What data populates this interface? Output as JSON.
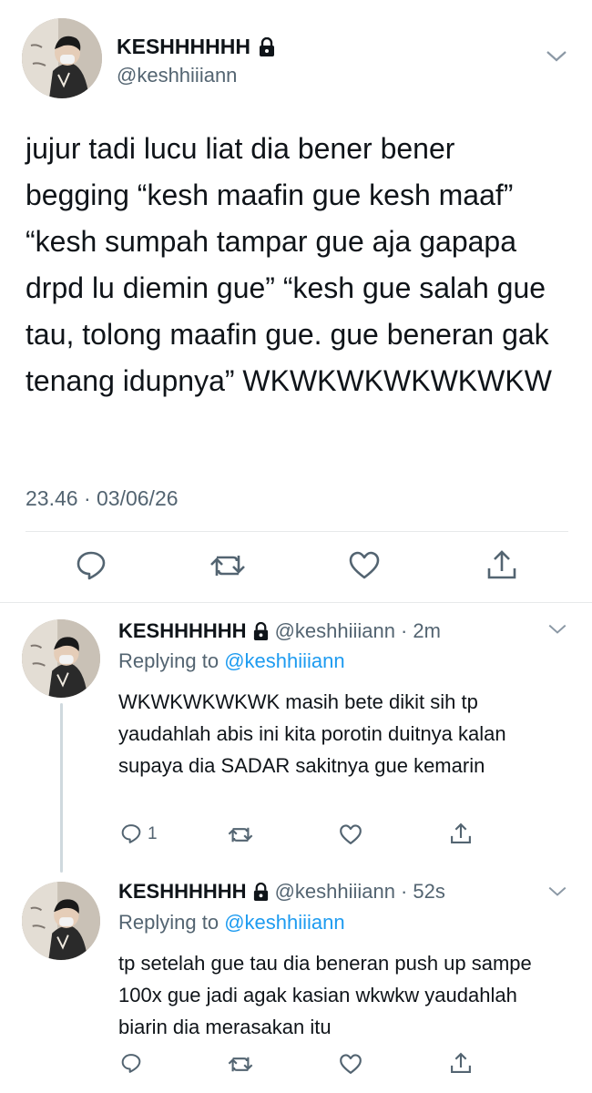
{
  "main_tweet": {
    "display_name": "KESHHHHHH",
    "handle": "@keshhiiiann",
    "text": "jujur tadi lucu liat dia bener bener begging “kesh maafin gue kesh maaf” “kesh sumpah tampar gue aja gapapa drpd lu diemin gue” “kesh gue salah gue tau, tolong maafin gue. gue beneran gak tenang idupnya” WKWKWKWKWKWKW",
    "timestamp": "23.46 · 03/06/26",
    "actions": [
      "reply-icon",
      "retweet-icon",
      "like-icon",
      "share-icon"
    ]
  },
  "replies": [
    {
      "display_name": "KESHHHHHH",
      "handle": "@keshhiiiann",
      "time": "· 2m",
      "replying_prefix": "Replying to ",
      "replying_to": "@keshhiiiann",
      "text": "WKWKWKWKWK masih bete dikit sih tp yaudahlah abis ini kita porotin duitnya kalan supaya dia SADAR sakitnya gue kemarin",
      "reply_count": "1"
    },
    {
      "display_name": "KESHHHHHH",
      "handle": "@keshhiiiann",
      "time": "· 52s",
      "replying_prefix": "Replying to ",
      "replying_to": "@keshhiiiann",
      "text": "tp setelah gue tau dia beneran push up sampe 100x gue jadi agak kasian wkwkw yaudahlah biarin dia merasakan itu",
      "reply_count": ""
    }
  ],
  "colors": {
    "link": "#1d9bf0",
    "secondary": "#536471",
    "icon": "#536471",
    "divider": "#e7e9ea"
  }
}
